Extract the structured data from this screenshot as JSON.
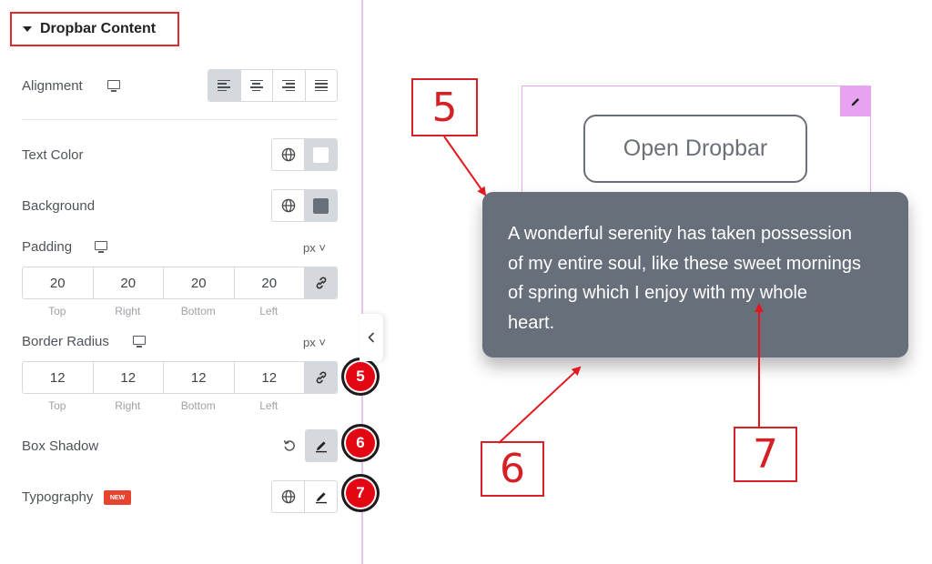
{
  "panel": {
    "section_title": "Dropbar Content",
    "alignment": {
      "label": "Alignment",
      "options": [
        "align-left",
        "align-center",
        "align-right",
        "align-justify"
      ],
      "selected": "align-left"
    },
    "text_color": {
      "label": "Text Color",
      "value": "#ffffff"
    },
    "background": {
      "label": "Background",
      "value": "#676f7b"
    },
    "padding": {
      "label": "Padding",
      "unit": "px",
      "values": {
        "top": "20",
        "right": "20",
        "bottom": "20",
        "left": "20"
      },
      "sub_labels": {
        "top": "Top",
        "right": "Right",
        "bottom": "Bottom",
        "left": "Left"
      }
    },
    "border_radius": {
      "label": "Border Radius",
      "unit": "px",
      "values": {
        "top": "12",
        "right": "12",
        "bottom": "12",
        "left": "12"
      },
      "sub_labels": {
        "top": "Top",
        "right": "Right",
        "bottom": "Bottom",
        "left": "Left"
      }
    },
    "box_shadow": {
      "label": "Box Shadow"
    },
    "typography": {
      "label": "Typography",
      "badge": "NEW"
    },
    "step_badges": {
      "border_radius": "5",
      "box_shadow": "6",
      "typography": "7"
    }
  },
  "preview": {
    "button_label": "Open Dropbar",
    "dropbar_lines": [
      "A wonderful serenity has taken possession",
      "of my entire soul, like these sweet mornings",
      "of spring which I enjoy with my whole",
      "heart."
    ]
  },
  "callouts": {
    "five": "5",
    "six": "6",
    "seven": "7"
  },
  "colors": {
    "accent_red": "#e30613",
    "frame_pink": "#e6a8f0",
    "dropbar_bg": "#676f7b"
  }
}
